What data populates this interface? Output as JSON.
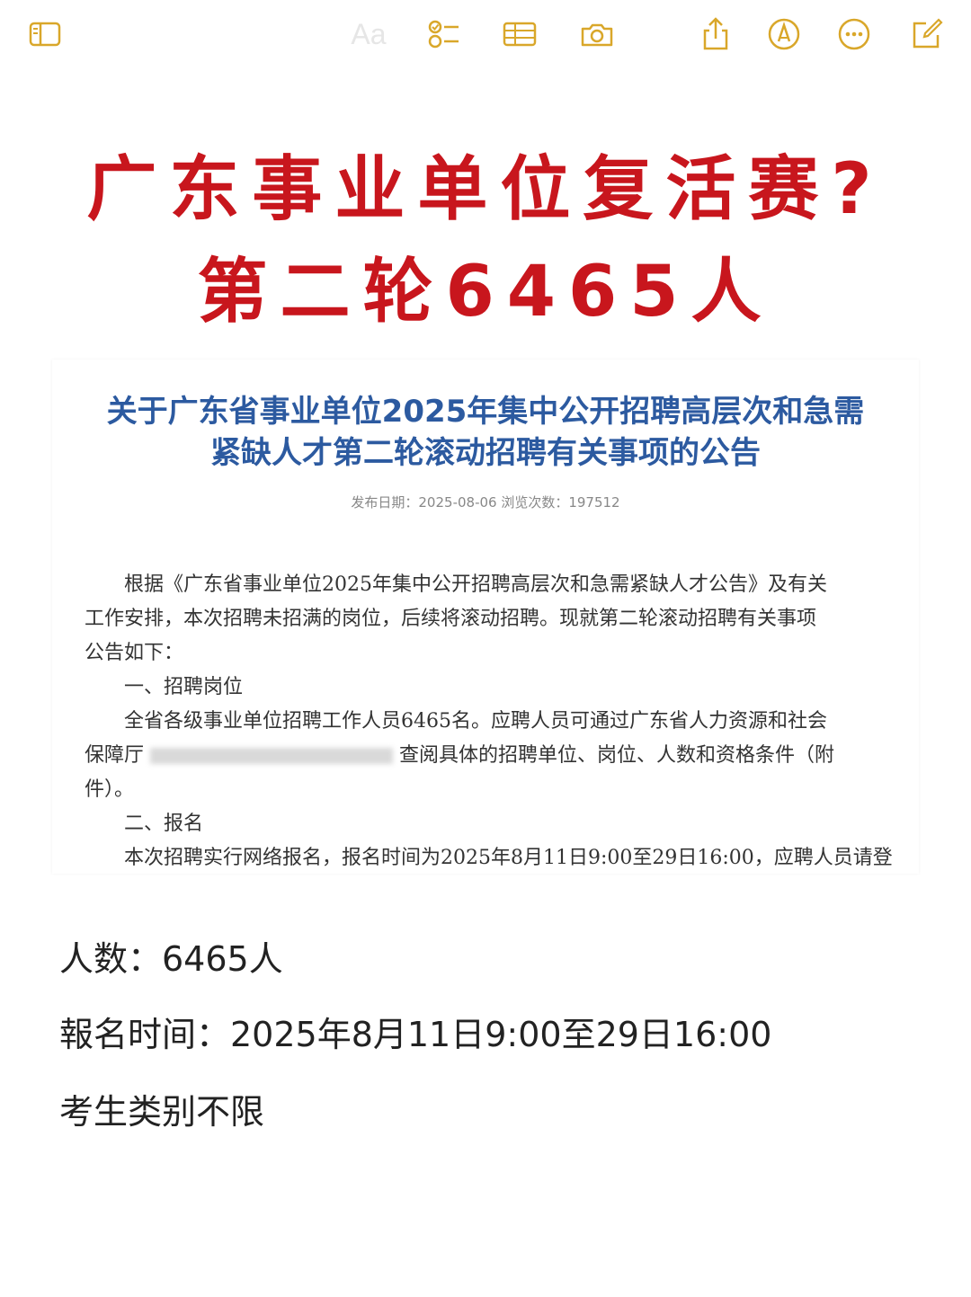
{
  "toolbar": {
    "aa_label": "Aa",
    "accent": "#d9a72a",
    "icons": [
      "sidebar-icon",
      "checklist-icon",
      "table-icon",
      "camera-icon",
      "share-icon",
      "markup-pen-icon",
      "more-icon",
      "compose-icon"
    ]
  },
  "headline": {
    "line1": "广东事业单位复活赛?",
    "line2": "第二轮6465人",
    "color": "#c8161d"
  },
  "document": {
    "title_line1": "关于广东省事业单位2025年集中公开招聘高层次和急需",
    "title_line2": "紧缺人才第二轮滚动招聘有关事项的公告",
    "meta": "发布日期：2025-08-06  浏览次数：197512",
    "title_color": "#2c5aa0",
    "lines": [
      "　　根据《广东省事业单位2025年集中公开招聘高层次和急需紧缺人才公告》及有关",
      "工作安排，本次招聘未招满的岗位，后续将滚动招聘。现就第二轮滚动招聘有关事项",
      "公告如下：",
      "　　一、招聘岗位",
      "　　全省各级事业单位招聘工作人员6465名。应聘人员可通过广东省人力资源和社会",
      "保障厅",
      "查阅具体的招聘单位、岗位、人数和资格条件（附",
      "件）。",
      "　　二、报名",
      "　本次招聘实行网络报名，报名时间为2025年8月11日9:00至29日16:00，应聘人员请登"
    ]
  },
  "info": {
    "count": "人数：6465人",
    "time": "報名时间：2025年8月11日9:00至29日16:00",
    "category": "考生类别不限"
  }
}
